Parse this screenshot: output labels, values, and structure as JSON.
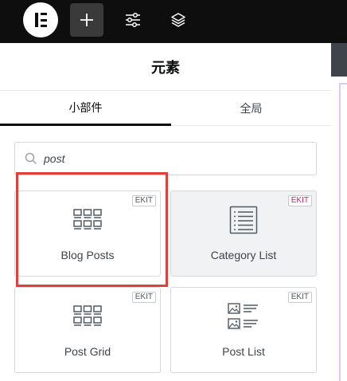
{
  "topbar": {
    "logo_icon": "elementor-logo-icon",
    "buttons": [
      {
        "icon": "plus-icon",
        "active": true
      },
      {
        "icon": "sliders-icon",
        "active": false
      },
      {
        "icon": "layers-icon",
        "active": false
      }
    ]
  },
  "panel": {
    "title": "元素",
    "tabs": [
      {
        "label": "小部件",
        "active": true
      },
      {
        "label": "全局",
        "active": false
      }
    ],
    "search": {
      "value": "post",
      "placeholder": "",
      "icon": "search-icon"
    },
    "widgets": [
      {
        "label": "Blog Posts",
        "badge": "EKIT",
        "icon": "grid-posts-icon",
        "highlighted": true
      },
      {
        "label": "Category List",
        "badge": "EKIT",
        "icon": "list-icon",
        "badge_color": "#c8245a"
      },
      {
        "label": "Post Grid",
        "badge": "EKIT",
        "icon": "grid-posts-icon"
      },
      {
        "label": "Post List",
        "badge": "EKIT",
        "icon": "image-list-icon"
      }
    ]
  },
  "colors": {
    "topbar_bg": "#0e0e0e",
    "highlight": "#e0403a",
    "accent_purple": "#e4c7f2"
  }
}
